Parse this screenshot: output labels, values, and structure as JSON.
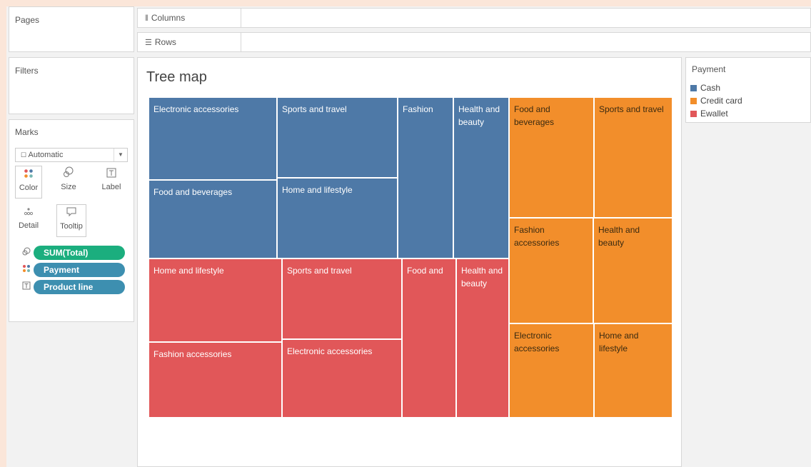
{
  "panels": {
    "pages_title": "Pages",
    "filters_title": "Filters",
    "marks_title": "Marks"
  },
  "shelves": {
    "columns_label": "Columns",
    "rows_label": "Rows"
  },
  "marks": {
    "mark_type": "Automatic",
    "buttons": {
      "color": "Color",
      "size": "Size",
      "label": "Label",
      "detail": "Detail",
      "tooltip": "Tooltip"
    },
    "pills": [
      {
        "label": "SUM(Total)",
        "color": "#1bae7e",
        "icon": "size-icon"
      },
      {
        "label": "Payment",
        "color": "#3d8fb0",
        "icon": "color-icon"
      },
      {
        "label": "Product line",
        "color": "#3d8fb0",
        "icon": "label-icon"
      }
    ]
  },
  "view": {
    "title": "Tree map"
  },
  "legend": {
    "title": "Payment",
    "items": [
      {
        "label": "Cash",
        "color": "#4e79a7"
      },
      {
        "label": "Credit card",
        "color": "#f28e2b"
      },
      {
        "label": "Ewallet",
        "color": "#e15759"
      }
    ]
  },
  "chart_data": {
    "type": "treemap",
    "title": "Tree map",
    "color_by": "Payment",
    "size_by": "SUM(Total)",
    "groups": [
      {
        "payment": "Cash",
        "color": "#4e79a7",
        "tiles": [
          {
            "label": "Electronic accessories"
          },
          {
            "label": "Food and beverages"
          },
          {
            "label": "Sports and travel"
          },
          {
            "label": "Home and lifestyle"
          },
          {
            "label": "Fashion"
          },
          {
            "label": "Health and beauty"
          }
        ]
      },
      {
        "payment": "Ewallet",
        "color": "#e15759",
        "tiles": [
          {
            "label": "Home and lifestyle"
          },
          {
            "label": "Fashion accessories"
          },
          {
            "label": "Sports and travel"
          },
          {
            "label": "Electronic accessories"
          },
          {
            "label": "Food and"
          },
          {
            "label": "Health and beauty"
          }
        ]
      },
      {
        "payment": "Credit card",
        "color": "#f28e2b",
        "tiles": [
          {
            "label": "Food and beverages"
          },
          {
            "label": "Sports and travel"
          },
          {
            "label": "Fashion accessories"
          },
          {
            "label": "Health and beauty"
          },
          {
            "label": "Electronic accessories"
          },
          {
            "label": "Home and lifestyle"
          }
        ]
      }
    ]
  }
}
